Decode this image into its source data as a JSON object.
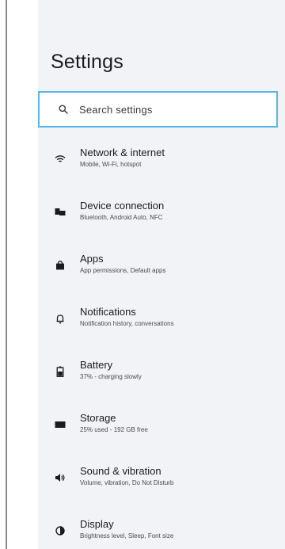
{
  "header": {
    "title": "Settings"
  },
  "search": {
    "placeholder": "Search settings",
    "icon": "search-icon"
  },
  "settings": {
    "items": [
      {
        "label": "Network & internet",
        "sub": "Mobile, Wi-Fi, hotspot",
        "icon": "wifi-icon"
      },
      {
        "label": "Device connection",
        "sub": "Bluetooth, Android Auto, NFC",
        "icon": "devices-icon"
      },
      {
        "label": "Apps",
        "sub": "App permissions, Default apps",
        "icon": "apps-icon"
      },
      {
        "label": "Notifications",
        "sub": "Notification history, conversations",
        "icon": "bell-icon"
      },
      {
        "label": "Battery",
        "sub": "37% - charging slowly",
        "icon": "battery-icon"
      },
      {
        "label": "Storage",
        "sub": "25% used - 192 GB free",
        "icon": "storage-icon"
      },
      {
        "label": "Sound & vibration",
        "sub": "Volume, vibration, Do Not Disturb",
        "icon": "speaker-icon"
      },
      {
        "label": "Display",
        "sub": "Brightness level, Sleep, Font size",
        "icon": "display-icon"
      }
    ]
  },
  "colors": {
    "background": "#f2f3f6",
    "search_border": "#5bb6e6",
    "text": "#1b1b1f"
  }
}
